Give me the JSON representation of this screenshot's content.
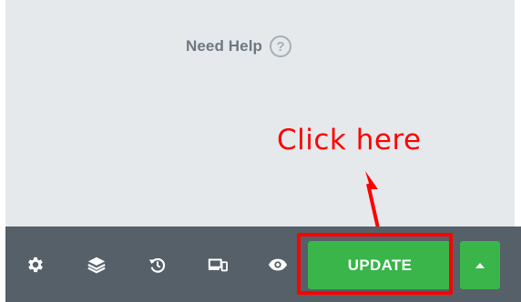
{
  "panel": {
    "help_label": "Need Help",
    "help_glyph": "?"
  },
  "annotation": {
    "text": "Click here",
    "color": "#ff0000"
  },
  "footer_bar": {
    "tools": [
      {
        "icon": "gear-icon"
      },
      {
        "icon": "layers-icon"
      },
      {
        "icon": "history-icon"
      },
      {
        "icon": "responsive-devices-icon"
      },
      {
        "icon": "eye-preview-icon"
      }
    ],
    "update_label": "UPDATE",
    "menu_icon": "caret-up-icon",
    "colors": {
      "bar": "#556068",
      "button": "#39b54a",
      "highlight": "#ff0000"
    }
  }
}
